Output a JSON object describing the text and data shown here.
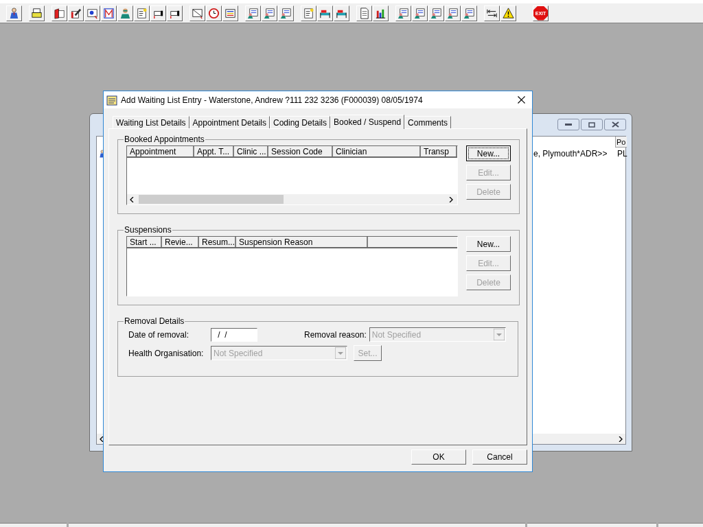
{
  "toolbar": {
    "exit_label": "EXIT"
  },
  "background_window": {
    "columns": [
      "Po"
    ],
    "row": [
      "e, Plymouth*ADR>>",
      "PL"
    ]
  },
  "dialog": {
    "title": "Add Waiting List Entry - Waterstone, Andrew ?111 232 3236 (F000039) 08/05/1974",
    "tabs": [
      {
        "label": "Waiting List Details",
        "selected": false
      },
      {
        "label": "Appointment Details",
        "selected": false
      },
      {
        "label": "Coding Details",
        "selected": false
      },
      {
        "label": "Booked / Suspend",
        "selected": true
      },
      {
        "label": "Comments",
        "selected": false
      }
    ],
    "booked": {
      "title": "Booked Appointments",
      "columns": [
        "Appointment",
        "Appt. T...",
        "Clinic ...",
        "Session Code",
        "Clinician",
        "Transp"
      ],
      "buttons": [
        {
          "label": "New...",
          "disabled": false,
          "focused": true
        },
        {
          "label": "Edit...",
          "disabled": true,
          "focused": false
        },
        {
          "label": "Delete",
          "disabled": true,
          "focused": false
        }
      ]
    },
    "suspensions": {
      "title": "Suspensions",
      "columns": [
        "Start ...",
        "Revie...",
        "Resum...",
        "Suspension Reason"
      ],
      "buttons": [
        {
          "label": "New...",
          "disabled": false,
          "focused": false
        },
        {
          "label": "Edit...",
          "disabled": true,
          "focused": false
        },
        {
          "label": "Delete",
          "disabled": true,
          "focused": false
        }
      ]
    },
    "removal": {
      "title": "Removal Details",
      "date_label": "Date of removal:",
      "date_value": " /  /",
      "reason_label": "Removal reason:",
      "reason": {
        "value": "Not Specified",
        "disabled": true
      },
      "org_label": "Health Organisation:",
      "org": {
        "value": "Not Specified",
        "disabled": true
      },
      "set_button": {
        "label": "Set...",
        "disabled": true
      }
    },
    "buttons": [
      "OK",
      "Cancel"
    ]
  }
}
